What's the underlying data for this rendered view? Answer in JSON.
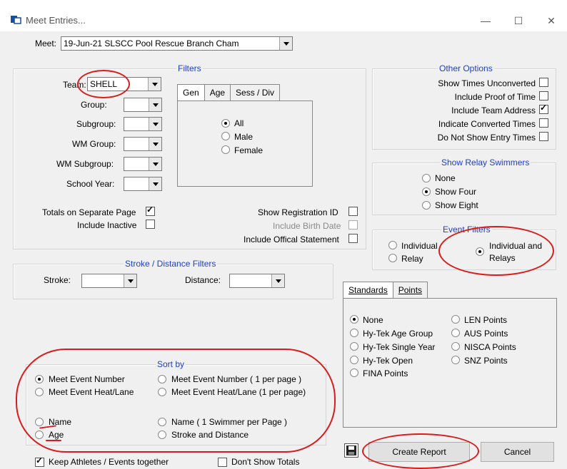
{
  "window": {
    "title": "Meet Entries...",
    "minimize": "—",
    "maximize": "☐",
    "close": "✕"
  },
  "meet": {
    "label": "Meet:",
    "value": "19-Jun-21 SLSCC Pool Rescue Branch Cham"
  },
  "filters": {
    "title": "Filters",
    "team_label": "Team:",
    "team_value": "SHELL",
    "group_label": "Group:",
    "subgroup_label": "Subgroup:",
    "wm_group_label": "WM Group:",
    "wm_subgroup_label": "WM Subgroup:",
    "school_year_label": "School Year:",
    "tabs": [
      "Gen",
      "Age",
      "Sess / Div"
    ],
    "gender_options": [
      "All",
      "Male",
      "Female"
    ],
    "totals_separate": "Totals on Separate Page",
    "include_inactive": "Include Inactive",
    "show_reg_id": "Show Registration ID",
    "include_birth_date": "Include Birth Date",
    "include_official_statement": "Include Offical Statement"
  },
  "other_options": {
    "title": "Other Options",
    "items": [
      "Show Times Unconverted",
      "Include Proof of Time",
      "Include Team Address",
      "Indicate Converted Times",
      "Do Not Show Entry Times"
    ]
  },
  "relay_swimmers": {
    "title": "Show Relay Swimmers",
    "options": [
      "None",
      "Show Four",
      "Show Eight"
    ]
  },
  "event_filters": {
    "title": "Event Filters",
    "individual": "Individual",
    "relay": "Relay",
    "both_line1": "Individual and",
    "both_line2": "Relays"
  },
  "stroke_filters": {
    "title": "Stroke / Distance Filters",
    "stroke_label": "Stroke:",
    "distance_label": "Distance:"
  },
  "standards": {
    "tabs": [
      "Standards",
      "Points"
    ],
    "col1": [
      "None",
      "Hy-Tek Age Group",
      "Hy-Tek Single Year",
      "Hy-Tek Open",
      "FINA Points"
    ],
    "col2": [
      "LEN Points",
      "AUS Points",
      "NISCA Points",
      "SNZ Points"
    ]
  },
  "sort_by": {
    "title": "Sort by",
    "col1": [
      "Meet Event Number",
      "Meet Event Heat/Lane",
      "Name",
      "Age"
    ],
    "col2": [
      "Meet Event Number ( 1 per page )",
      "Meet Event Heat/Lane (1 per page)",
      "Name ( 1 Swimmer per Page )",
      "Stroke and Distance"
    ]
  },
  "bottom": {
    "keep_together": "Keep Athletes / Events together",
    "dont_show_totals": "Don't Show Totals"
  },
  "buttons": {
    "create_report": "Create Report",
    "cancel": "Cancel"
  },
  "colors": {
    "group_title": "#1f3fbf",
    "annotation": "#d81c1c",
    "dialog_bg": "#f0f0f0"
  }
}
